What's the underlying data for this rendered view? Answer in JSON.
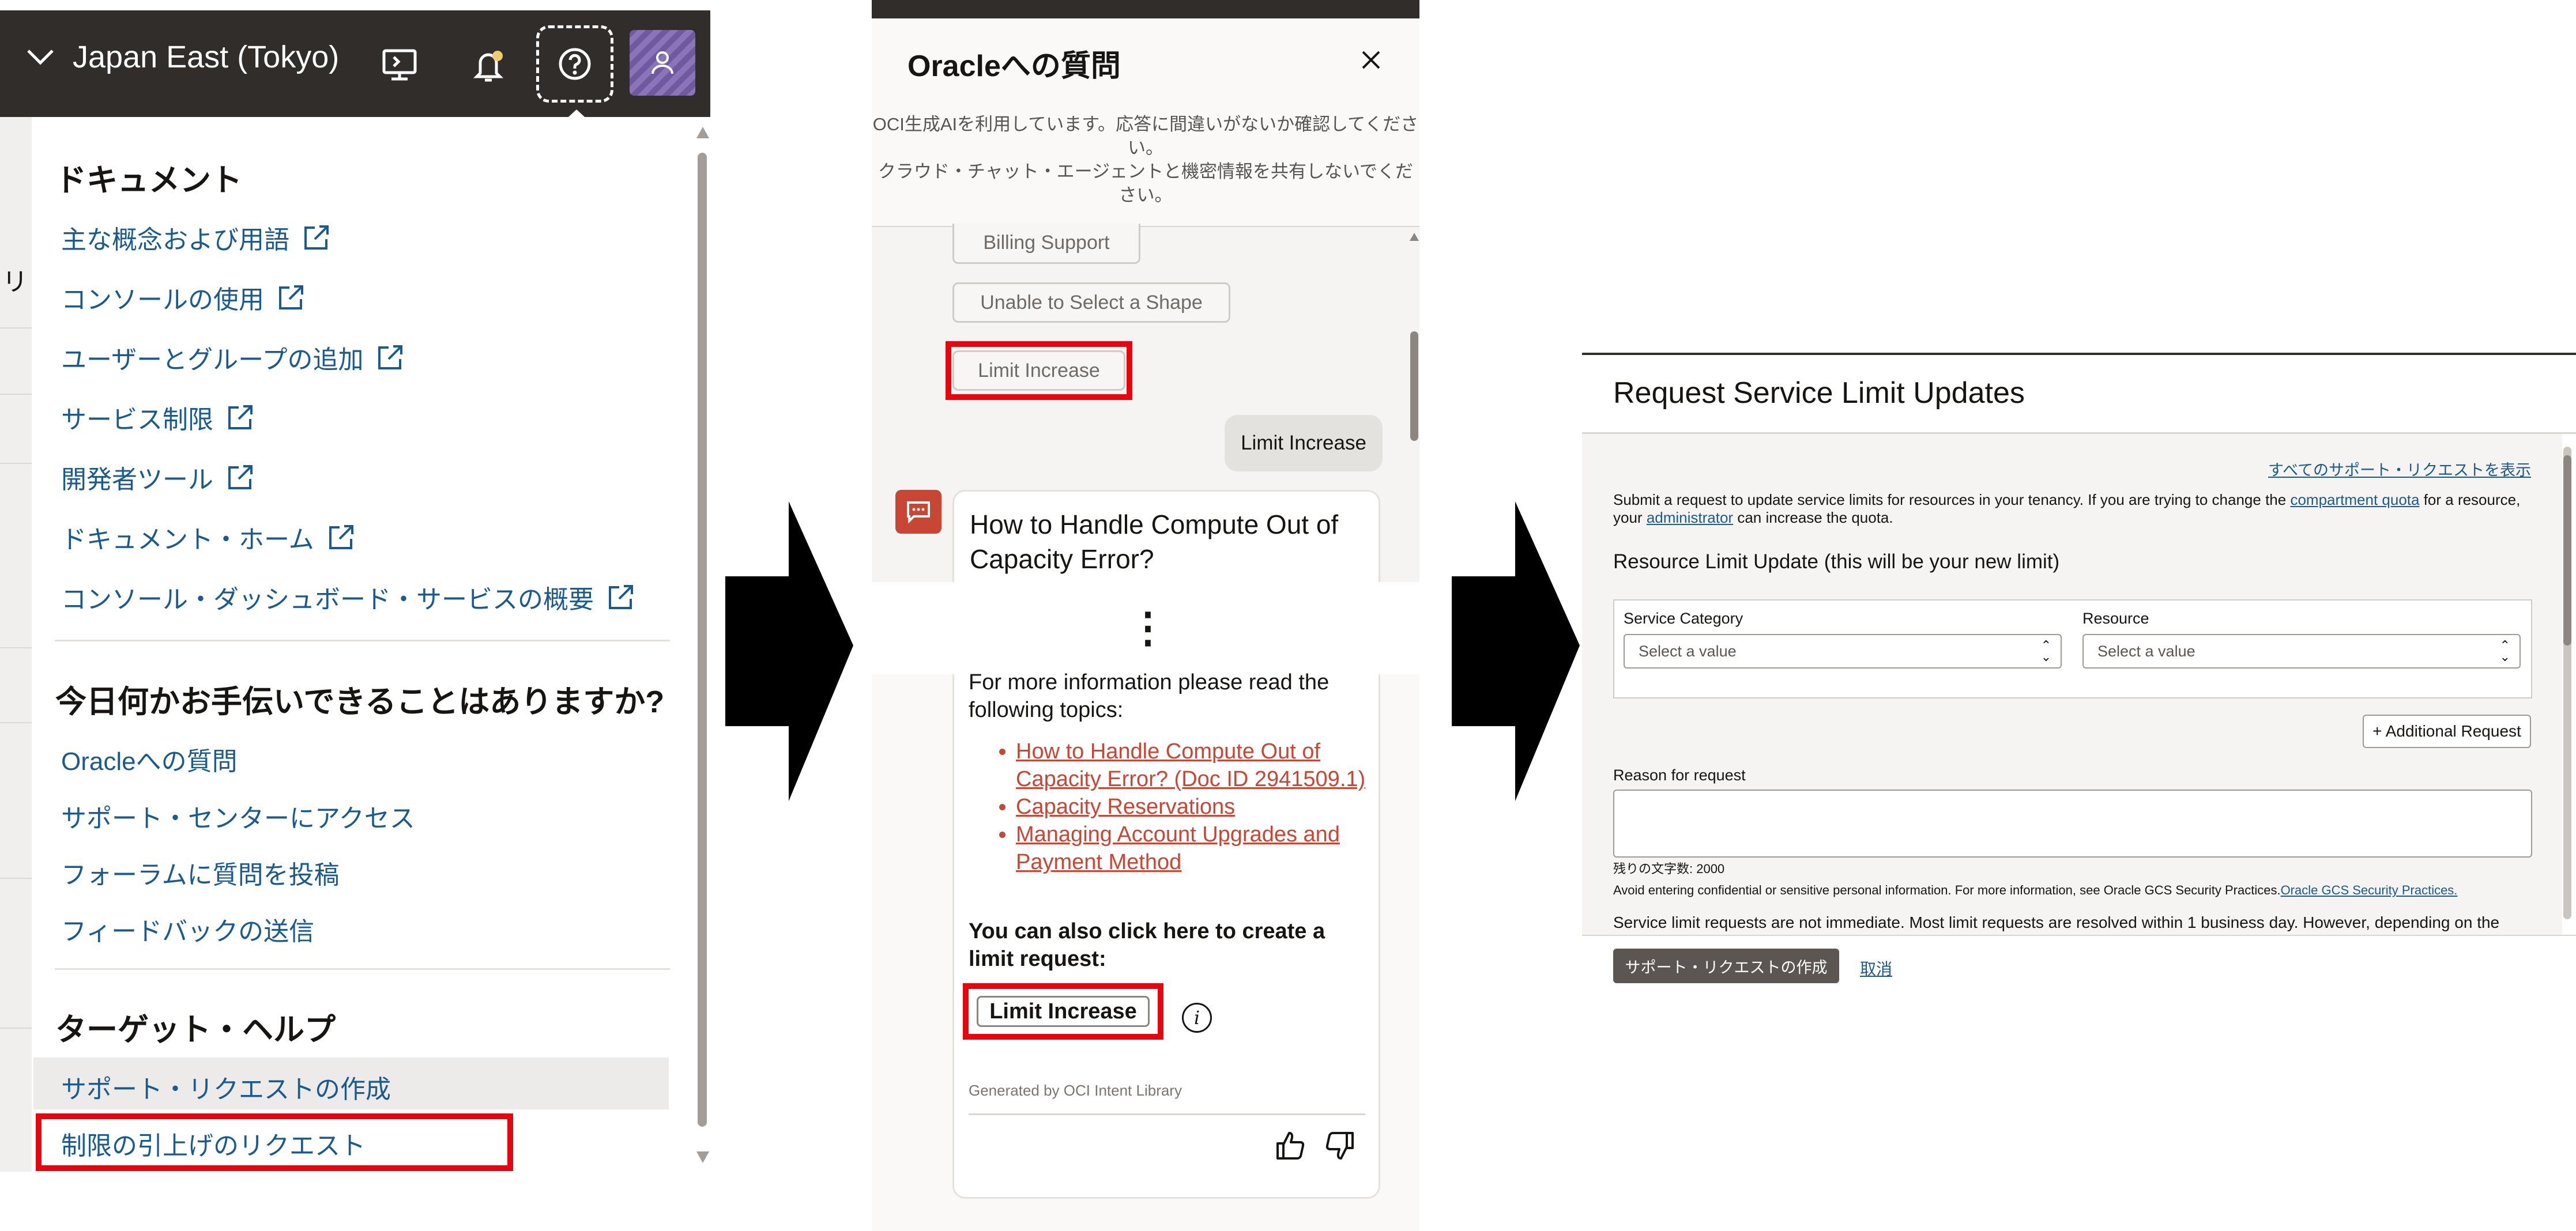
{
  "panel1": {
    "region": "Japan East (Tokyo)",
    "left_edge_char": "リ",
    "sections": {
      "documents": {
        "heading": "ドキュメント",
        "links": [
          "主な概念および用語",
          "コンソールの使用",
          "ユーザーとグループの追加",
          "サービス制限",
          "開発者ツール",
          "ドキュメント・ホーム",
          "コンソール・ダッシュボード・サービスの概要"
        ]
      },
      "help": {
        "heading": "今日何かお手伝いできることはありますか?",
        "links": [
          "Oracleへの質問",
          "サポート・センターにアクセス",
          "フォーラムに質問を投稿",
          "フィードバックの送信"
        ]
      },
      "targeted": {
        "heading": "ターゲット・ヘルプ",
        "links": [
          "サポート・リクエストの作成",
          "制限の引上げのリクエスト"
        ]
      }
    }
  },
  "panel2": {
    "title": "Oracleへの質問",
    "notice_line1": "OCI生成AIを利用しています。応答に間違いがないか確認してください。",
    "notice_line2": "クラウド・チャット・エージェントと機密情報を共有しないでください。",
    "chips": [
      "Billing Support",
      "Unable to Select a Shape",
      "Limit Increase"
    ],
    "user_message": "Limit Increase",
    "card": {
      "title": "How to Handle Compute Out of Capacity Error?",
      "ellipsis": "⋮",
      "more_info": "For more information please read the following topics:",
      "topics": [
        "How to Handle Compute Out of Capacity Error? (Doc ID 2941509.1)",
        "Capacity Reservations",
        "Managing Account Upgrades and Payment Method"
      ],
      "also_click": "You can also click here to create a limit request:",
      "limit_button": "Limit Increase",
      "info_glyph": "i",
      "generated": "Generated by OCI Intent Library"
    }
  },
  "panel3": {
    "title": "Request Service Limit Updates",
    "view_all": "すべてのサポート・リクエストを表示",
    "desc_part1": "Submit a request to update service limits for resources in your tenancy. If you are trying to change the ",
    "desc_link1": "compartment quota",
    "desc_part2": " for a resource, your ",
    "desc_link2": "administrator",
    "desc_part3": " can increase the quota.",
    "section_title": "Resource Limit Update (this will be your new limit)",
    "service_category_label": "Service Category",
    "service_category_value": "Select a value",
    "resource_label": "Resource",
    "resource_value": "Select a value",
    "additional_request": "+ Additional Request",
    "reason_label": "Reason for request",
    "remaining": "残りの文字数: 2000",
    "avoid_text": "Avoid entering confidential or sensitive personal information. For more information, see Oracle GCS Security Practices.",
    "avoid_link": "Oracle GCS Security Practices.",
    "note": "Service limit requests are not immediate. Most limit requests are resolved within 1 business day. However, depending on the",
    "create_button": "サポート・リクエストの作成",
    "cancel_link": "取消"
  },
  "colors": {
    "header_dark": "#312d2a",
    "link_blue": "#1a5a8c",
    "highlight_red": "#e8050e",
    "oracle_red": "#c74634"
  }
}
